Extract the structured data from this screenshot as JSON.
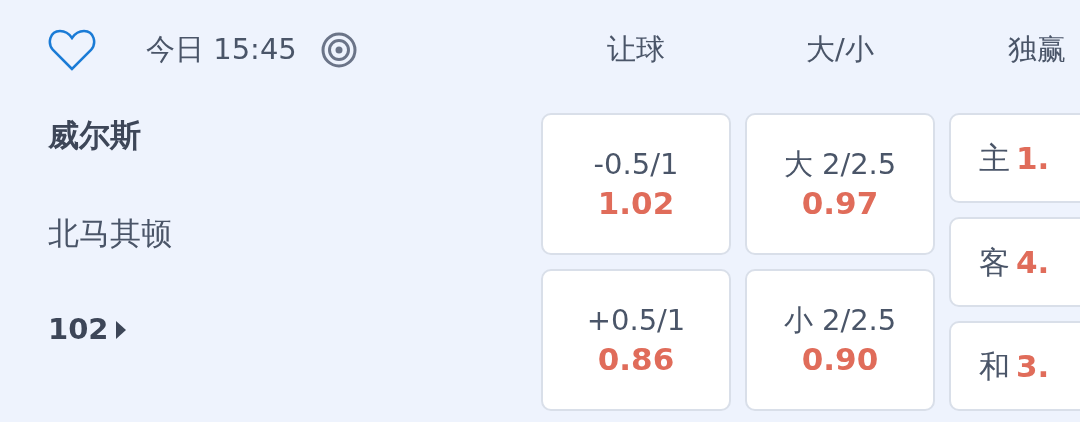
{
  "header": {
    "favorited": false,
    "time": "今日 15:45",
    "columns": [
      "让球",
      "大/小",
      "独赢"
    ]
  },
  "teams": [
    {
      "name": "威尔斯",
      "emphasized": true
    },
    {
      "name": "北马其顿",
      "emphasized": false
    }
  ],
  "more": {
    "count": "102"
  },
  "handicap": [
    {
      "line": "-0.5/1",
      "odds": "1.02"
    },
    {
      "line": "+0.5/1",
      "odds": "0.86"
    }
  ],
  "over_under": [
    {
      "line": "大 2/2.5",
      "odds": "0.97"
    },
    {
      "line": "小 2/2.5",
      "odds": "0.90"
    }
  ],
  "moneyline": [
    {
      "label": "主",
      "odds": "1."
    },
    {
      "label": "客",
      "odds": "4."
    },
    {
      "label": "和",
      "odds": "3."
    }
  ]
}
